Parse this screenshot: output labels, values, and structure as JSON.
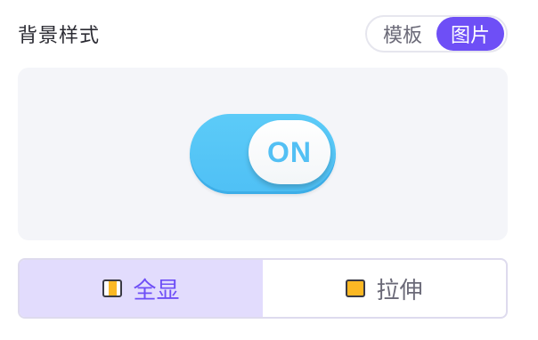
{
  "header": {
    "title": "背景样式",
    "tabs": [
      {
        "label": "模板",
        "active": false
      },
      {
        "label": "图片",
        "active": true
      }
    ]
  },
  "preview": {
    "toggle_text": "ON",
    "toggle_state": "on"
  },
  "mode": {
    "options": [
      {
        "label": "全显",
        "icon": "fit-image-icon",
        "active": true
      },
      {
        "label": "拉伸",
        "icon": "stretch-image-icon",
        "active": false
      }
    ]
  },
  "colors": {
    "accent": "#6e4ff6",
    "accent_light": "#e2dcfd",
    "toggle_blue": "#5ccbf8",
    "icon_yellow": "#fbb824",
    "preview_bg": "#f4f5f9"
  }
}
